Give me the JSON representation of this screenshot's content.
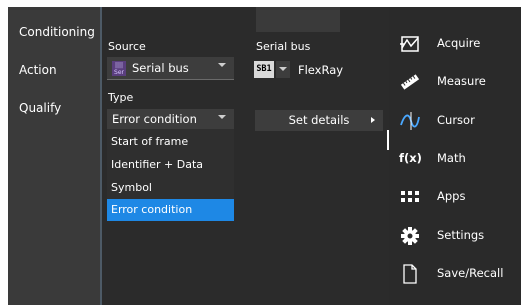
{
  "left_menu": [
    {
      "label": "Conditioning"
    },
    {
      "label": "Action"
    },
    {
      "label": "Qualify"
    }
  ],
  "source": {
    "label": "Source",
    "icon_text": "Ser",
    "value": "Serial bus"
  },
  "serial_bus": {
    "label": "Serial bus",
    "badge": "SB1",
    "value": "FlexRay"
  },
  "type": {
    "label": "Type",
    "value": "Error condition",
    "options": [
      {
        "label": "Start of frame"
      },
      {
        "label": "Identifier + Data"
      },
      {
        "label": "Symbol"
      },
      {
        "label": "Error condition"
      }
    ],
    "selected_index": 3
  },
  "set_details": {
    "label": "Set details"
  },
  "right_menu": [
    {
      "label": "Acquire",
      "icon": "acquire-icon"
    },
    {
      "label": "Measure",
      "icon": "ruler-icon"
    },
    {
      "label": "Cursor",
      "icon": "cursor-icon"
    },
    {
      "label": "Math",
      "icon": "math-icon",
      "icon_text": "f(x)"
    },
    {
      "label": "Apps",
      "icon": "apps-icon"
    },
    {
      "label": "Settings",
      "icon": "gear-icon"
    },
    {
      "label": "Save/Recall",
      "icon": "document-icon"
    }
  ],
  "colors": {
    "accent": "#1e88e5",
    "background": "#2b2b2b",
    "panel": "#3a3a3a",
    "control": "#3d3d3d"
  }
}
